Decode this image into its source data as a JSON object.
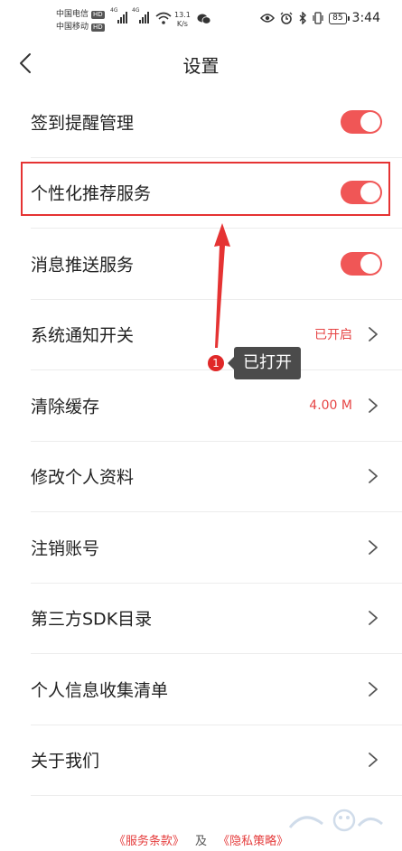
{
  "status_bar": {
    "carrier1": "中国电信",
    "carrier2": "中国移动",
    "hd": "HD",
    "net_type": "4G",
    "speed_value": "13.1",
    "speed_unit": "K/s",
    "battery": "85",
    "time": "3:44"
  },
  "nav": {
    "title": "设置"
  },
  "settings": [
    {
      "label": "签到提醒管理",
      "control": "toggle",
      "on": true
    },
    {
      "label": "个性化推荐服务",
      "control": "toggle",
      "on": true
    },
    {
      "label": "消息推送服务",
      "control": "toggle",
      "on": true
    },
    {
      "label": "系统通知开关",
      "control": "chevron",
      "value": "已开启"
    },
    {
      "label": "清除缓存",
      "control": "chevron",
      "value": "4.00 M"
    },
    {
      "label": "修改个人资料",
      "control": "chevron"
    },
    {
      "label": "注销账号",
      "control": "chevron"
    },
    {
      "label": "第三方SDK目录",
      "control": "chevron"
    },
    {
      "label": "个人信息收集清单",
      "control": "chevron"
    },
    {
      "label": "关于我们",
      "control": "chevron"
    }
  ],
  "annotation": {
    "step": "1",
    "tip": "已打开"
  },
  "footer": {
    "terms": "《服务条款》",
    "and": "及",
    "privacy": "《隐私策略》"
  },
  "colors": {
    "accent": "#f05656",
    "highlight": "#e53333",
    "value_text": "#e64545"
  }
}
